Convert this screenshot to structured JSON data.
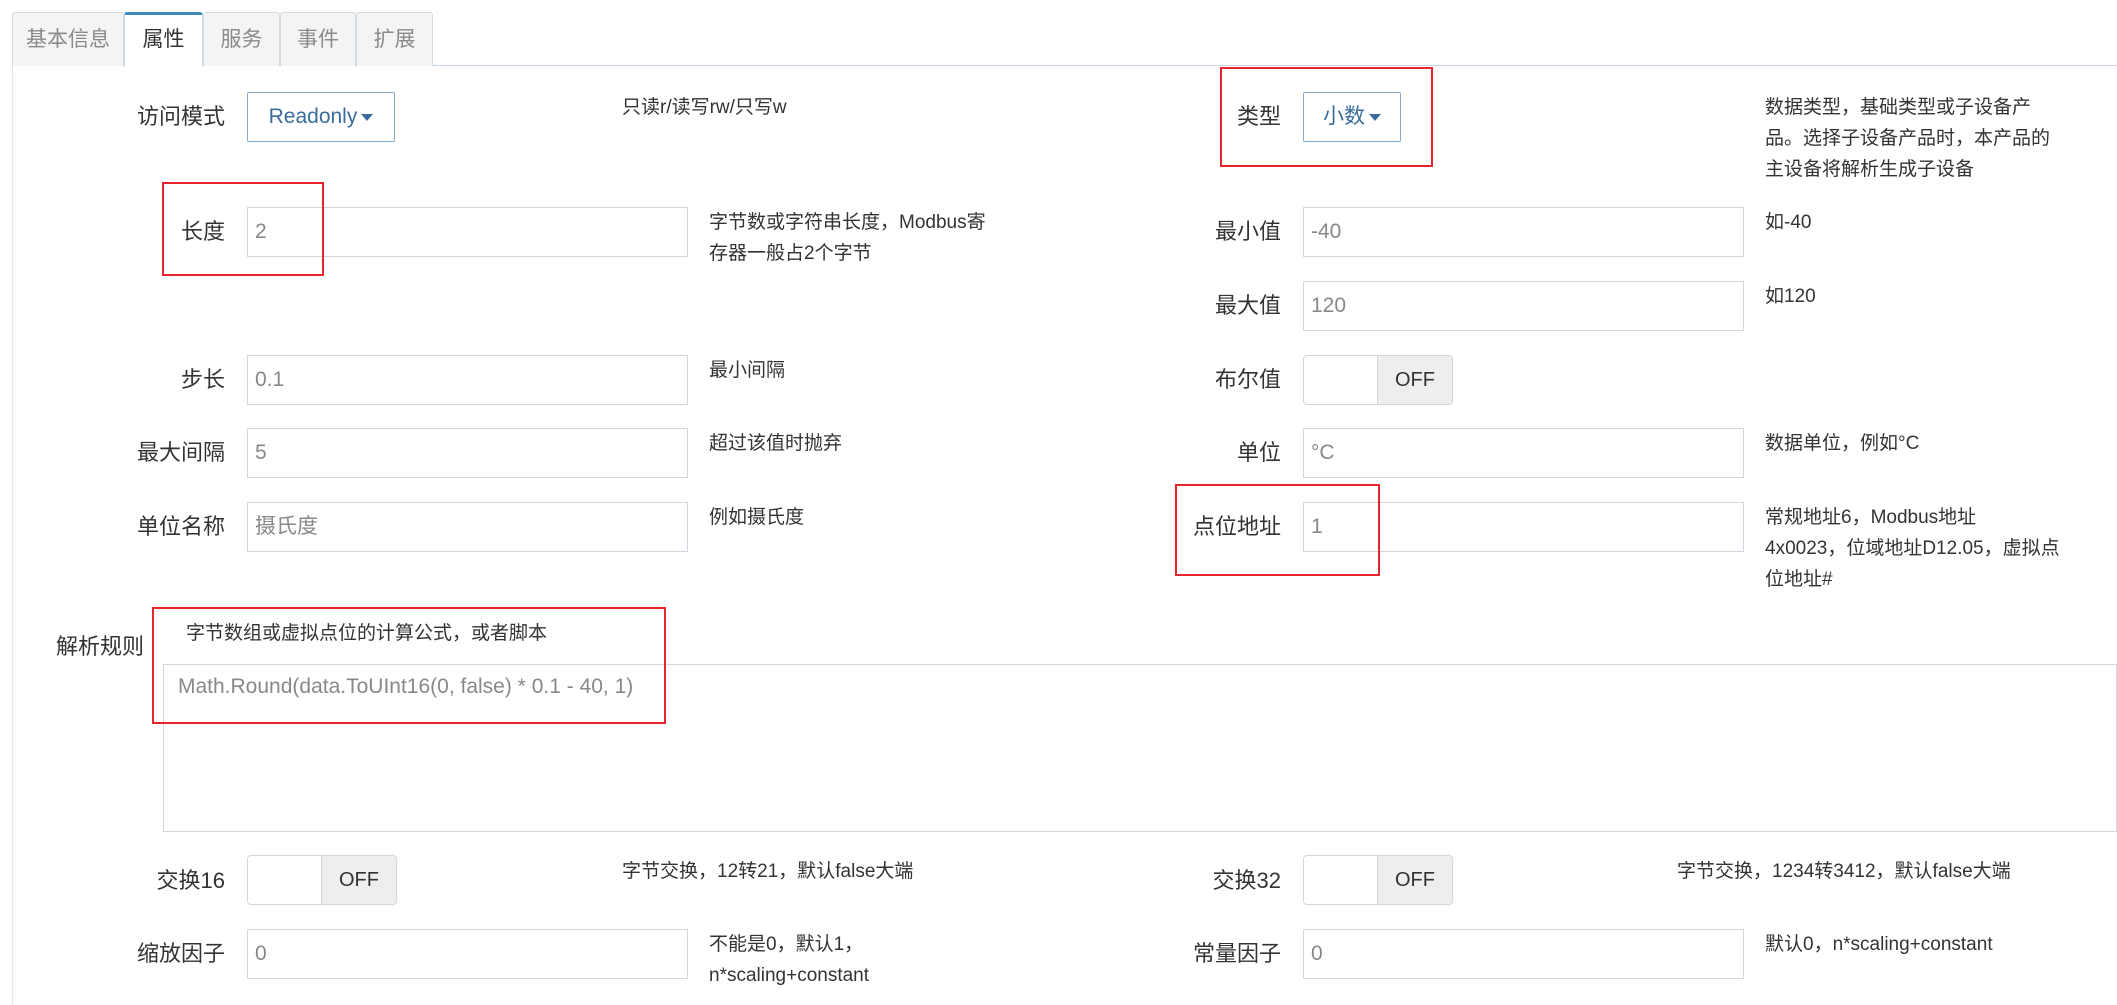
{
  "tabs": [
    {
      "label": "基本信息",
      "active": false
    },
    {
      "label": "属性",
      "active": true
    },
    {
      "label": "服务",
      "active": false
    },
    {
      "label": "事件",
      "active": false
    },
    {
      "label": "扩展",
      "active": false
    }
  ],
  "left": {
    "access_mode": {
      "label": "访问模式",
      "value": "Readonly",
      "help": "只读r/读写rw/只写w"
    },
    "length": {
      "label": "长度",
      "value": "2",
      "help_line1": "字节数或字符串长度，Modbus寄",
      "help_line2": "存器一般占2个字节"
    },
    "step": {
      "label": "步长",
      "value": "0.1",
      "help": "最小间隔"
    },
    "max_interval": {
      "label": "最大间隔",
      "value": "5",
      "help": "超过该值时抛弃"
    },
    "unit_name": {
      "label": "单位名称",
      "value": "摄氏度",
      "help": "例如摄氏度"
    },
    "swap16": {
      "label": "交换16",
      "state": "OFF",
      "help": "字节交换，12转21，默认false大端"
    },
    "scaling": {
      "label": "缩放因子",
      "value": "0",
      "help_line1": "不能是0，默认1，",
      "help_line2": "n*scaling+constant"
    }
  },
  "right": {
    "type": {
      "label": "类型",
      "value": "小数",
      "help_line1": "数据类型，基础类型或子设备产",
      "help_line2": "品。选择子设备产品时，本产品的",
      "help_line3": "主设备将解析生成子设备"
    },
    "min": {
      "label": "最小值",
      "value": "-40",
      "help": "如-40"
    },
    "max": {
      "label": "最大值",
      "value": "120",
      "help": "如120"
    },
    "bool": {
      "label": "布尔值",
      "state": "OFF"
    },
    "unit": {
      "label": "单位",
      "value": "°C",
      "help": "数据单位，例如°C"
    },
    "address": {
      "label": "点位地址",
      "value": "1",
      "help_line1": "常规地址6，Modbus地址",
      "help_line2": "4x0023，位域地址D12.05，虚拟点",
      "help_line3": "位地址#"
    },
    "swap32": {
      "label": "交换32",
      "state": "OFF",
      "help": "字节交换，1234转3412，默认false大端"
    },
    "constant": {
      "label": "常量因子",
      "value": "0",
      "help": "默认0，n*scaling+constant"
    }
  },
  "parse_rule": {
    "label": "解析规则",
    "help": "字节数组或虚拟点位的计算公式，或者脚本",
    "value": "Math.Round(data.ToUInt16(0, false) * 0.1 - 40, 1)"
  },
  "colors": {
    "highlight": "#e8252d",
    "accent": "#3c8dbc"
  }
}
